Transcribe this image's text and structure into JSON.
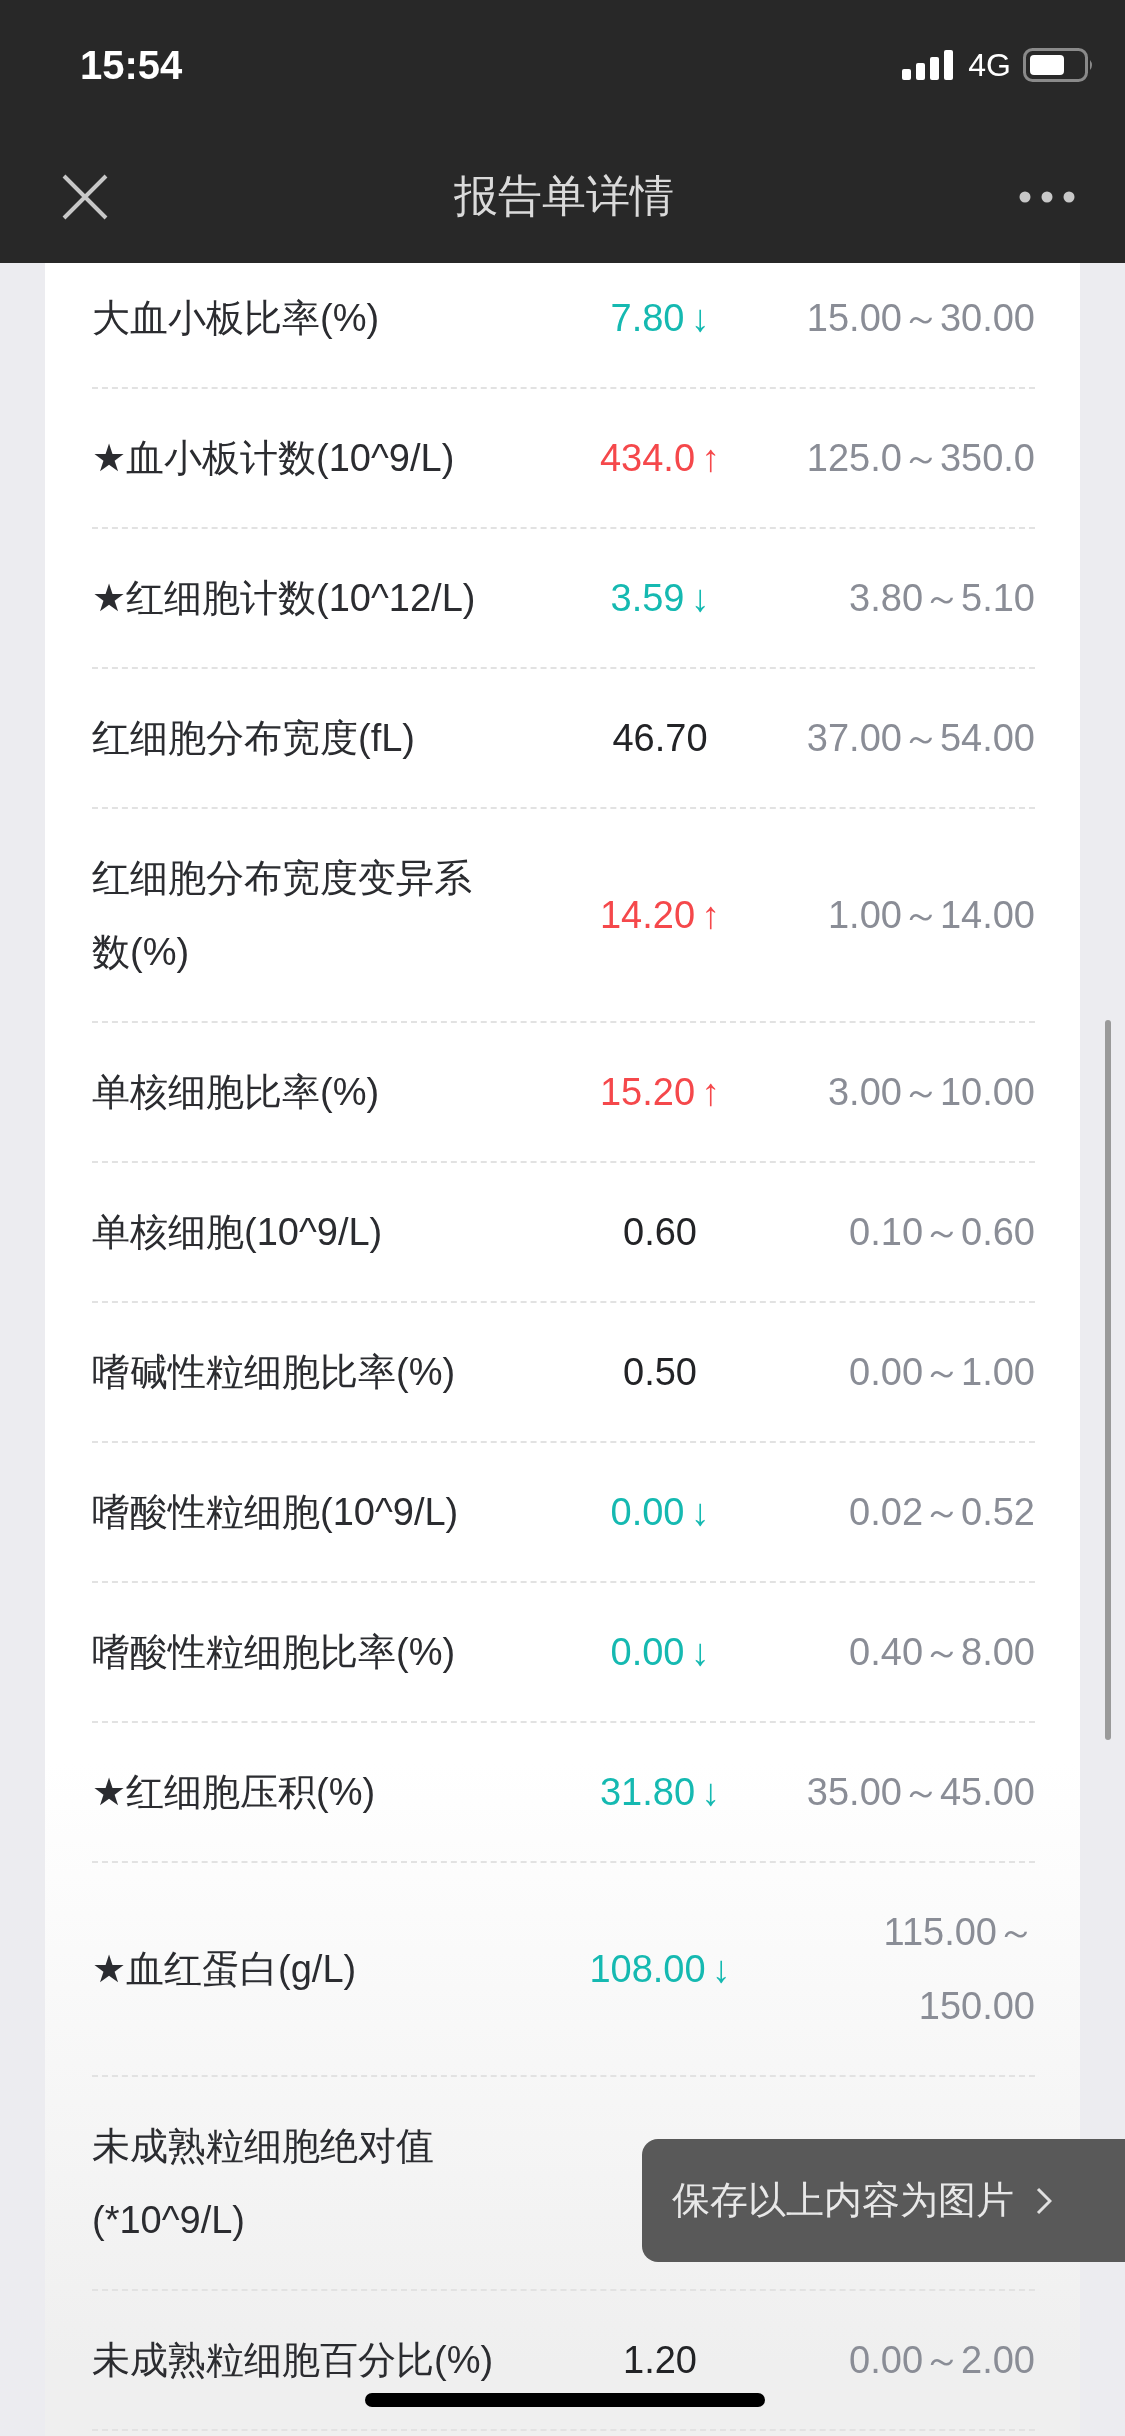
{
  "status_bar": {
    "time": "15:54",
    "network": "4G"
  },
  "nav": {
    "title": "报告单详情"
  },
  "rows": [
    {
      "name": "大血小板比率(%)",
      "value": "7.80",
      "color": "#15b9b1",
      "arrow": "↓",
      "range": "15.00～30.00"
    },
    {
      "name": "★血小板计数(10^9/L)",
      "value": "434.0",
      "color": "#f5484b",
      "arrow": "↑",
      "range": "125.0～350.0"
    },
    {
      "name": "★红细胞计数(10^12/L)",
      "value": "3.59",
      "color": "#15b9b1",
      "arrow": "↓",
      "range": "3.80～5.10"
    },
    {
      "name": "红细胞分布宽度(fL)",
      "value": "46.70",
      "color": "#222326",
      "range": "37.00～54.00"
    },
    {
      "name": "红细胞分布宽度变异系数(%)",
      "value": "14.20",
      "color": "#f5484b",
      "arrow": "↑",
      "range": "1.00～14.00"
    },
    {
      "name": "单核细胞比率(%)",
      "value": "15.20",
      "color": "#f5484b",
      "arrow": "↑",
      "range": "3.00～10.00"
    },
    {
      "name": "单核细胞(10^9/L)",
      "value": "0.60",
      "color": "#222326",
      "range": "0.10～0.60"
    },
    {
      "name": "嗜碱性粒细胞比率(%)",
      "value": "0.50",
      "color": "#222326",
      "range": "0.00～1.00"
    },
    {
      "name": "嗜酸性粒细胞(10^9/L)",
      "value": "0.00",
      "color": "#15b9b1",
      "arrow": "↓",
      "range": "0.02～0.52"
    },
    {
      "name": "嗜酸性粒细胞比率(%)",
      "value": "0.00",
      "color": "#15b9b1",
      "arrow": "↓",
      "range": "0.40～8.00"
    },
    {
      "name": "★红细胞压积(%)",
      "value": "31.80",
      "color": "#15b9b1",
      "arrow": "↓",
      "range": "35.00～45.00"
    },
    {
      "name": "★血红蛋白(g/L)",
      "value": "108.00",
      "color": "#15b9b1",
      "arrow": "↓",
      "range": "115.00～150.00"
    },
    {
      "name": "未成熟粒细胞绝对值(*10^9/L)"
    },
    {
      "name": "未成熟粒细胞百分比(%)",
      "value": "1.20",
      "color": "#222326",
      "range": "0.00～2.00"
    }
  ],
  "toast": {
    "label": "保存以上内容为图片"
  }
}
